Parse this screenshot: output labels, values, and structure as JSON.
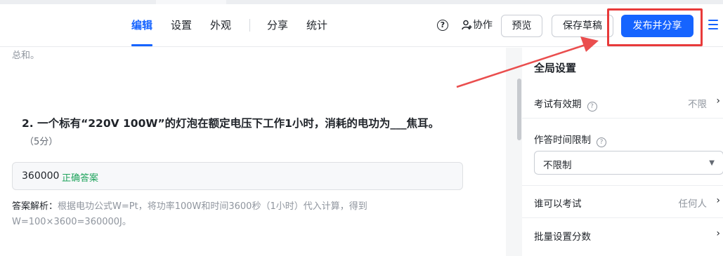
{
  "header": {
    "tabs": [
      {
        "label": "编辑",
        "active": true
      },
      {
        "label": "设置",
        "active": false
      },
      {
        "label": "外观",
        "active": false
      },
      {
        "label": "分享",
        "active": false
      },
      {
        "label": "统计",
        "active": false
      }
    ],
    "help_icon": "question-circle-icon",
    "collab_label": "协作",
    "preview_label": "预览",
    "save_draft_label": "保存草稿",
    "publish_label": "发布并分享",
    "menu_icon": "hamburger-menu-icon",
    "accent_color": "#1664ff",
    "highlight_color": "#e83a3a"
  },
  "main": {
    "prev_text": "总和。",
    "question": {
      "title": "2. 一个标有“220V 100W”的灯泡在额定电压下工作1小时，消耗的电功为___焦耳。",
      "score": "（5分）",
      "answer_value": "360000",
      "answer_tag": "正确答案",
      "analysis_label": "答案解析：",
      "analysis_text": "根据电功公式W=Pt，将功率100W和时间3600秒（1小时）代入计算，得到W=100×3600=360000J。"
    }
  },
  "panel": {
    "title": "全局设置",
    "validity_label": "考试有效期",
    "validity_value": "不限",
    "time_limit_label": "作答时间限制",
    "time_limit_selected": "不限制",
    "who_label": "谁可以考试",
    "who_value": "任何人",
    "batch_score_label": "批量设置分数"
  }
}
